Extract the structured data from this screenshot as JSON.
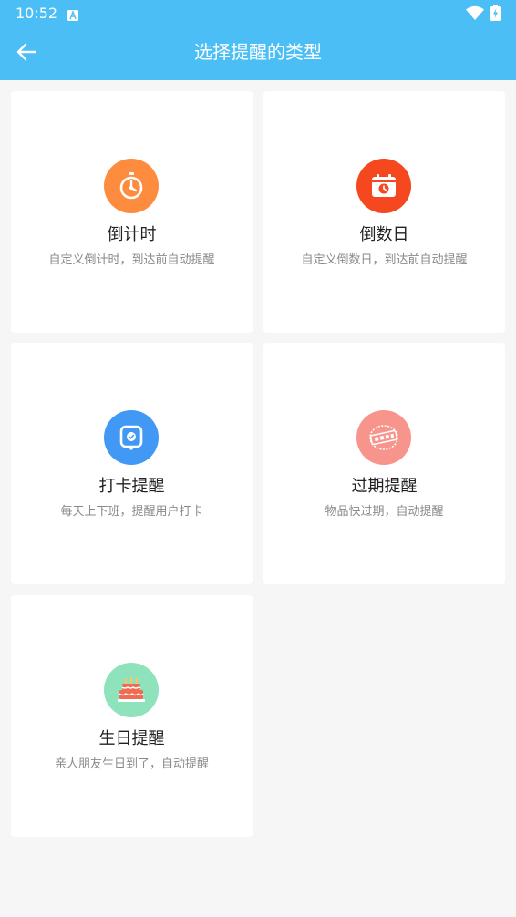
{
  "status_bar": {
    "time": "10:52"
  },
  "header": {
    "title": "选择提醒的类型"
  },
  "colors": {
    "header_bg": "#4cbef6",
    "countdown": "#fe8c3f",
    "countday": "#f6481f",
    "checkin": "#4198f5",
    "expiry": "#f7948c",
    "birthday": "#8ee3bc"
  },
  "cards": [
    {
      "icon": "stopwatch-icon",
      "title": "倒计时",
      "desc": "自定义倒计时，到达前自动提醒"
    },
    {
      "icon": "calendar-clock-icon",
      "title": "倒数日",
      "desc": "自定义倒数日，到达前自动提醒"
    },
    {
      "icon": "checkin-badge-icon",
      "title": "打卡提醒",
      "desc": "每天上下班，提醒用户打卡"
    },
    {
      "icon": "expiry-stamp-icon",
      "title": "过期提醒",
      "desc": "物品快过期，自动提醒"
    },
    {
      "icon": "birthday-cake-icon",
      "title": "生日提醒",
      "desc": "亲人朋友生日到了，自动提醒"
    }
  ]
}
